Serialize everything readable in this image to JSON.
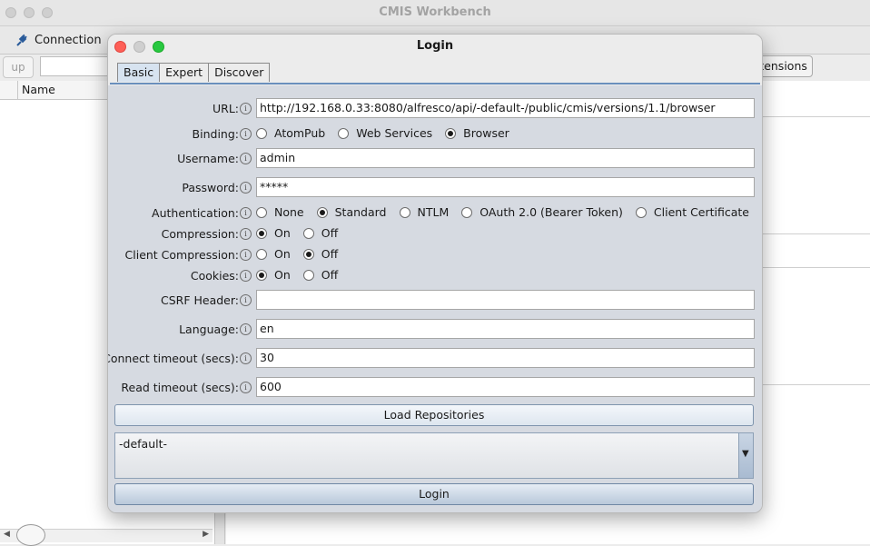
{
  "main_window": {
    "title": "CMIS Workbench",
    "connection_label": "Connection",
    "up_label": "up",
    "extensions_label": "Extensions",
    "name_column": "Name"
  },
  "dialog": {
    "title": "Login",
    "tabs": [
      {
        "label": "Basic",
        "active": true
      },
      {
        "label": "Expert",
        "active": false
      },
      {
        "label": "Discover",
        "active": false
      }
    ],
    "info_glyph": "i",
    "url": {
      "label": "URL:",
      "value": "http://192.168.0.33:8080/alfresco/api/-default-/public/cmis/versions/1.1/browser"
    },
    "binding": {
      "label": "Binding:",
      "options": [
        "AtomPub",
        "Web Services",
        "Browser"
      ],
      "selected": "Browser"
    },
    "username": {
      "label": "Username:",
      "value": "admin"
    },
    "password": {
      "label": "Password:",
      "value": "*****"
    },
    "authentication": {
      "label": "Authentication:",
      "options": [
        "None",
        "Standard",
        "NTLM",
        "OAuth 2.0 (Bearer Token)",
        "Client Certificate"
      ],
      "selected": "Standard"
    },
    "compression": {
      "label": "Compression:",
      "options": [
        "On",
        "Off"
      ],
      "selected": "On"
    },
    "client_compression": {
      "label": "Client Compression:",
      "options": [
        "On",
        "Off"
      ],
      "selected": "Off"
    },
    "cookies": {
      "label": "Cookies:",
      "options": [
        "On",
        "Off"
      ],
      "selected": "On"
    },
    "csrf_header": {
      "label": "CSRF Header:",
      "value": ""
    },
    "language": {
      "label": "Language:",
      "value": "en"
    },
    "connect_timeout": {
      "label": "Connect timeout (secs):",
      "value": "30"
    },
    "read_timeout": {
      "label": "Read timeout (secs):",
      "value": "600"
    },
    "load_repositories_label": "Load Repositories",
    "repositories": [
      "-default-"
    ],
    "dropdown_arrow": "▼",
    "login_label": "Login"
  },
  "colors": {
    "close": "#fe5f57",
    "zoom": "#28c840",
    "tab_active": "#d7e3f0",
    "panel": "#d6dae1"
  }
}
